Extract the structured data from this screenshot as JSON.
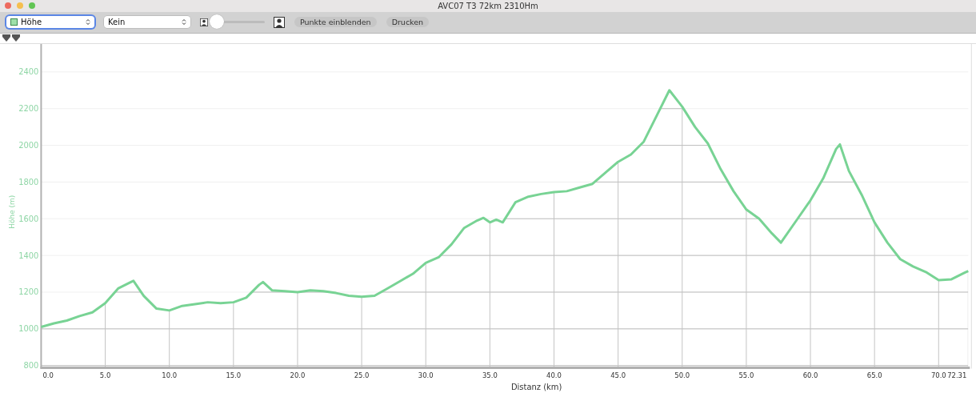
{
  "window": {
    "title": "AVC07 T3 72km 2310Hm"
  },
  "toolbar": {
    "metric_select": {
      "value": "Höhe",
      "focused": true
    },
    "second_select": {
      "value": "Kein",
      "focused": false
    },
    "zoom_slider": {
      "level": 0
    },
    "buttons": [
      "Punkte einblenden",
      "Drucken"
    ]
  },
  "markers": [
    {
      "kind": "marker"
    },
    {
      "kind": "marker"
    }
  ],
  "chart": {
    "chart_data": {
      "type": "line",
      "xlabel": "Distanz (km)",
      "ylabel": "Höhe (m)",
      "x": [
        0,
        1,
        2,
        3,
        4,
        5,
        6,
        7,
        7.2,
        8,
        9,
        10,
        11,
        12,
        13,
        14,
        15,
        16,
        17,
        17.3,
        18,
        19,
        20,
        21,
        22,
        23,
        24,
        25,
        26,
        27,
        28,
        29,
        30,
        31,
        32,
        33,
        34,
        34.5,
        35,
        35.5,
        36,
        37,
        38,
        39,
        40,
        41,
        42,
        43,
        44,
        45,
        46,
        47,
        48,
        49,
        50,
        51,
        52,
        53,
        54,
        55,
        56,
        57,
        57.7,
        58,
        59,
        60,
        61,
        62,
        62.3,
        63,
        64,
        65,
        66,
        67,
        68,
        69,
        70,
        71,
        72,
        72.31
      ],
      "series": [
        {
          "color": "#78d394",
          "values": [
            1010,
            1030,
            1045,
            1070,
            1090,
            1140,
            1220,
            1255,
            1262,
            1180,
            1110,
            1100,
            1125,
            1135,
            1145,
            1140,
            1145,
            1170,
            1240,
            1255,
            1210,
            1205,
            1200,
            1210,
            1205,
            1195,
            1180,
            1175,
            1180,
            1220,
            1260,
            1300,
            1360,
            1390,
            1460,
            1550,
            1590,
            1605,
            1580,
            1595,
            1580,
            1690,
            1720,
            1735,
            1745,
            1750,
            1770,
            1790,
            1850,
            1910,
            1950,
            2020,
            2160,
            2300,
            2210,
            2100,
            2010,
            1870,
            1750,
            1650,
            1600,
            1520,
            1470,
            1500,
            1600,
            1700,
            1820,
            1980,
            2005,
            1860,
            1730,
            1580,
            1470,
            1380,
            1340,
            1310,
            1265,
            1270,
            1305,
            1315
          ]
        }
      ],
      "grid": true,
      "xlim": [
        0,
        72.31
      ],
      "ylim": [
        792,
        2552
      ],
      "xticks": [
        {
          "value": 0,
          "label": "0.0"
        },
        {
          "value": 5,
          "label": "5.0"
        },
        {
          "value": 10,
          "label": "10.0"
        },
        {
          "value": 15,
          "label": "15.0"
        },
        {
          "value": 20,
          "label": "20.0"
        },
        {
          "value": 25,
          "label": "25.0"
        },
        {
          "value": 30,
          "label": "30.0"
        },
        {
          "value": 35,
          "label": "35.0"
        },
        {
          "value": 40,
          "label": "40.0"
        },
        {
          "value": 45,
          "label": "45.0"
        },
        {
          "value": 50,
          "label": "50.0"
        },
        {
          "value": 55,
          "label": "55.0"
        },
        {
          "value": 60,
          "label": "60.0"
        },
        {
          "value": 65,
          "label": "65.0"
        },
        {
          "value": 70,
          "label": "70.0"
        },
        {
          "value": 72.31,
          "label": "72.31"
        }
      ],
      "yticks": [
        800,
        1000,
        1200,
        1400,
        1600,
        1800,
        2000,
        2200,
        2400
      ]
    }
  }
}
